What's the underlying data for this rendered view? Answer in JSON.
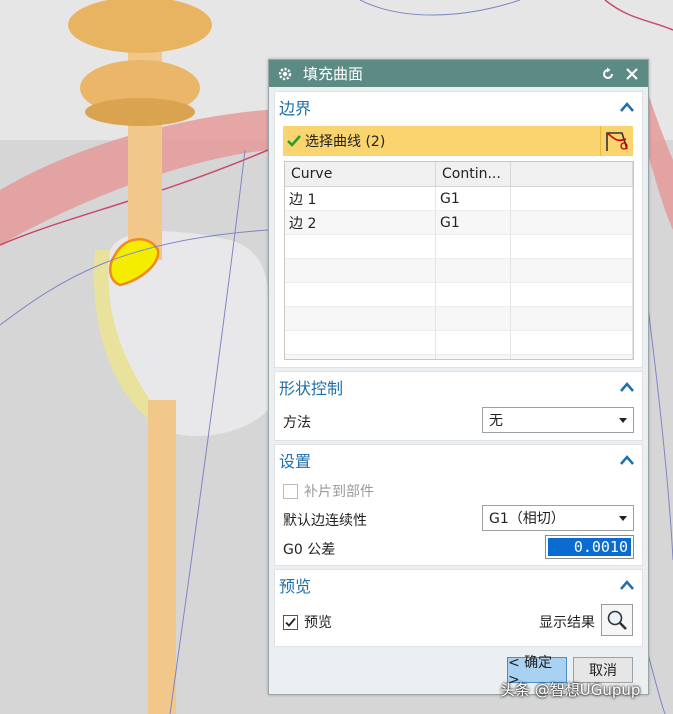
{
  "dialog": {
    "title": "填充曲面",
    "colors": {
      "titlebar": "#5c8b86",
      "section_title": "#1f6fa8",
      "selection_bar": "#fad46e",
      "highlight": "#0a6bd1"
    }
  },
  "boundary": {
    "section_title": "边界",
    "select_label": "选择曲线 (2)",
    "columns": [
      "Curve",
      "Contin..."
    ],
    "rows": [
      {
        "curve": "边 1",
        "continuity": "G1"
      },
      {
        "curve": "边 2",
        "continuity": "G1"
      }
    ]
  },
  "shape_control": {
    "section_title": "形状控制",
    "method_label": "方法",
    "method_value": "无"
  },
  "settings": {
    "section_title": "设置",
    "patch_label": "补片到部件",
    "patch_checked": false,
    "continuity_label": "默认边连续性",
    "continuity_value": "G1（相切）",
    "tolerance_label": "G0 公差",
    "tolerance_value": "0.0010"
  },
  "preview": {
    "section_title": "预览",
    "preview_label": "预览",
    "preview_checked": true,
    "show_result_label": "显示结果"
  },
  "footer": {
    "ok_label": "< 确定 >",
    "cancel_label": "取消"
  },
  "watermark": "头条 @智想UGupup"
}
